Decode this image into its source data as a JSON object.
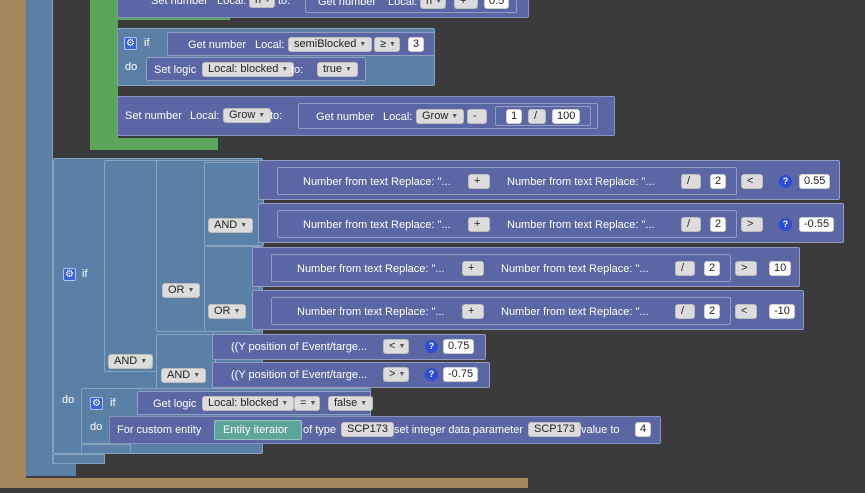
{
  "colors": {
    "background": "#3b3b3b",
    "math_block": "#5b67a5",
    "logic_block": "#5b80a5",
    "loop_block": "#5ba55b",
    "event_block": "#a5875b"
  },
  "top_partial": {
    "set_number": "Set number",
    "local_var": "Local: ",
    "to": "to:",
    "get_number": "Get number",
    "local_var2": "Local: ",
    "op": "+",
    "value": "0.5"
  },
  "if_semi": {
    "if": "if",
    "do": "do",
    "get_number": "Get number",
    "local": "Local:",
    "var": "semiBlocked",
    "op": "≥",
    "value": "3",
    "set_logic": "Set logic",
    "logic_var": "Local: blocked",
    "to": "to:",
    "bool": "true"
  },
  "set_grow": {
    "set_number": "Set number",
    "local": "Local:",
    "var": "Grow",
    "to": "to:",
    "get_number": "Get number",
    "local2": "Local:",
    "var2": "Grow",
    "op": "-",
    "n1": "1",
    "div": "/",
    "n2": "100"
  },
  "main_if": {
    "if": "if",
    "do": "do",
    "and1": "AND",
    "or1": "OR",
    "and2": "AND",
    "and3": "AND",
    "or2": "OR",
    "rows": [
      {
        "a": "Number from text Replace: \"...",
        "plus": "+",
        "b": "Number from text Replace: \"...",
        "div": "/",
        "two": "2",
        "cmp": "<",
        "val": "0.55",
        "q": "?"
      },
      {
        "a": "Number from text Replace: \"...",
        "plus": "+",
        "b": "Number from text Replace: \"...",
        "div": "/",
        "two": "2",
        "cmp": ">",
        "val": "-0.55",
        "q": "?"
      },
      {
        "a": "Number from text Replace: \"...",
        "plus": "+",
        "b": "Number from text Replace: \"...",
        "div": "/",
        "two": "2",
        "cmp": ">",
        "val": "10"
      },
      {
        "a": "Number from text Replace: \"...",
        "plus": "+",
        "b": "Number from text Replace: \"...",
        "div": "/",
        "two": "2",
        "cmp": "<",
        "val": "-10"
      }
    ],
    "ypos": [
      {
        "label": "((Y position of Event/targe...",
        "cmp": "<",
        "q": "?",
        "val": "0.75"
      },
      {
        "label": "((Y position of Event/targe...",
        "cmp": ">",
        "q": "?",
        "val": "-0.75"
      }
    ]
  },
  "inner_if": {
    "if": "if",
    "do": "do",
    "get_logic": "Get logic",
    "var": "Local: blocked",
    "op": "=",
    "bool": "false",
    "for_custom": "For custom entity",
    "iterator": "Entity iterator",
    "of_type": "of type",
    "type_val": "SCP173",
    "set_param": "set integer data parameter",
    "param": "SCP173",
    "value_to": "value to",
    "value": "4"
  }
}
